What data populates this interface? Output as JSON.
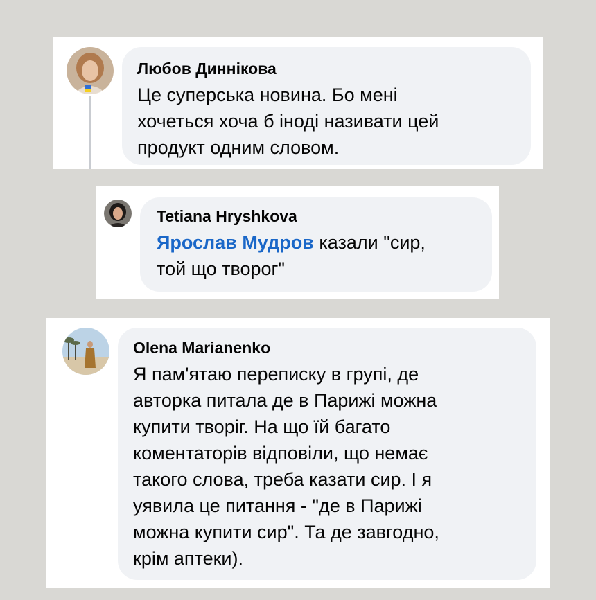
{
  "comments": [
    {
      "author": "Любов Диннікова",
      "text": "Це суперська новина. Бо мені\nхочеться хоча б іноді називати цей\nпродукт одним словом."
    },
    {
      "author": "Tetiana Hryshkova",
      "mention": "Ярослав Мудров",
      "text": " казали \"сир,\nтой що творог\""
    },
    {
      "author": "Olena Marianenko",
      "text": "Я пам'ятаю переписку в групі, де\nавторка питала де в Парижі можна\nкупити творіг. На що їй багато\nкоментаторів відповіли, що немає\nтакого слова, треба казати сир. І я\nуявила це питання - \"де в Парижі\nможна купити сир\". Та де завгодно,\nкрім аптеки)."
    }
  ],
  "colors": {
    "background": "#d9d8d4",
    "bubble": "#f0f2f5",
    "mention": "#1a67c8"
  },
  "icons": {
    "avatar_1": "woman-portrait-with-ukraine-flag-avatar",
    "avatar_2": "woman-portrait-avatar",
    "avatar_3": "woman-on-beach-avatar"
  }
}
